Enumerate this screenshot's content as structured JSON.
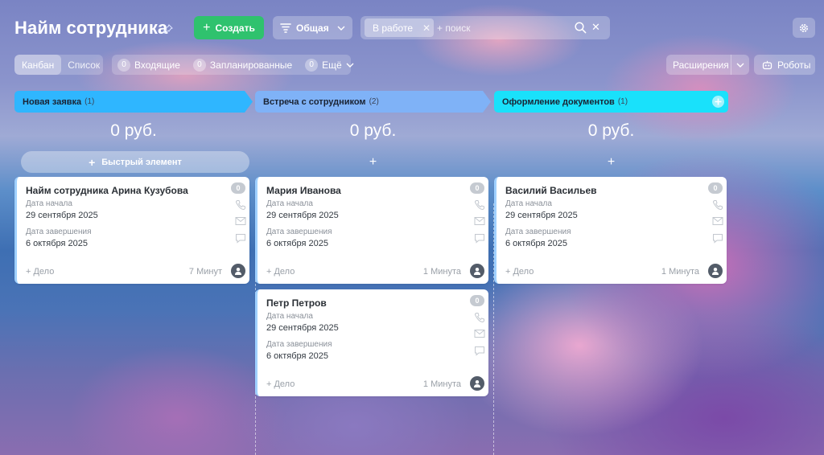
{
  "header": {
    "title": "Найм сотрудника",
    "create_label": "Создать",
    "general_label": "Общая",
    "filter_chip": "В работе",
    "search_placeholder": "+ поиск"
  },
  "toolbar": {
    "views": [
      "Канбан",
      "Список"
    ],
    "active_view": "Канбан",
    "counters": [
      {
        "count": "0",
        "label": "Входящие"
      },
      {
        "count": "0",
        "label": "Запланированные"
      },
      {
        "count": "0",
        "label": "Ещё"
      }
    ],
    "extensions_label": "Расширения",
    "robots_label": "Роботы"
  },
  "colors": {
    "accent_green": "#2fc26e",
    "stage_new": "#2fb6ff",
    "stage_meeting": "#7fb2f7",
    "stage_docs": "#19e1fb"
  },
  "columns": [
    {
      "title": "Новая заявка",
      "count": "(1)",
      "sum": "0 руб.",
      "quick_add": "Быстрый элемент",
      "cards": [
        {
          "name": "Найм сотрудника Арина Кузубова",
          "start_label": "Дата начала",
          "start": "29 сентября 2025",
          "end_label": "Дата завершения",
          "end": "6 октября 2025",
          "badge": "0",
          "deal": "+ Дело",
          "time": "7 Минут"
        }
      ]
    },
    {
      "title": "Встреча с сотрудником",
      "count": "(2)",
      "sum": "0 руб.",
      "cards": [
        {
          "name": "Мария Иванова",
          "start_label": "Дата начала",
          "start": "29 сентября 2025",
          "end_label": "Дата завершения",
          "end": "6 октября 2025",
          "badge": "0",
          "deal": "+ Дело",
          "time": "1 Минута"
        },
        {
          "name": "Петр Петров",
          "start_label": "Дата начала",
          "start": "29 сентября 2025",
          "end_label": "Дата завершения",
          "end": "6 октября 2025",
          "badge": "0",
          "deal": "+ Дело",
          "time": "1 Минута"
        }
      ]
    },
    {
      "title": "Оформление документов",
      "count": "(1)",
      "sum": "0 руб.",
      "cards": [
        {
          "name": "Василий Васильев",
          "start_label": "Дата начала",
          "start": "29 сентября 2025",
          "end_label": "Дата завершения",
          "end": "6 октября 2025",
          "badge": "0",
          "deal": "+ Дело",
          "time": "1 Минута"
        }
      ]
    }
  ]
}
